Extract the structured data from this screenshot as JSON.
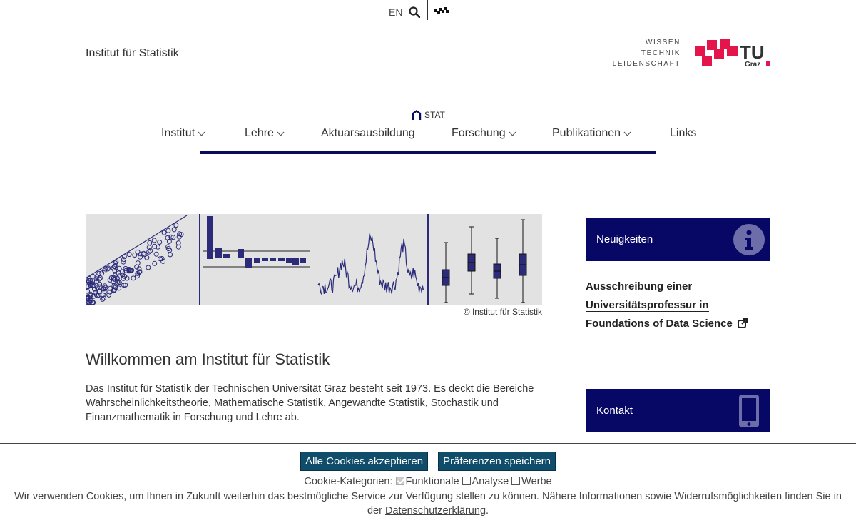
{
  "topbar": {
    "lang": "EN",
    "search_icon": "search-icon",
    "logo_icon": "tu-logo-small-icon"
  },
  "header": {
    "institute": "Institut für Statistik",
    "motto": [
      "WISSEN",
      "TECHNIK",
      "LEIDENSCHAFT"
    ],
    "logo_text": "TU",
    "logo_sub": "Graz"
  },
  "nav": {
    "home_label": "STAT",
    "items": [
      {
        "label": "Institut",
        "dropdown": true
      },
      {
        "label": "Lehre",
        "dropdown": true
      },
      {
        "label": "Aktuarsausbildung",
        "dropdown": false
      },
      {
        "label": "Forschung",
        "dropdown": true
      },
      {
        "label": "Publikationen",
        "dropdown": true
      },
      {
        "label": "Links",
        "dropdown": false
      }
    ]
  },
  "banner": {
    "credit": "© Institut für Statistik"
  },
  "main": {
    "title": "Willkommen am Institut für Statistik",
    "intro": "Das Institut für Statistik der Technischen Universität Graz besteht seit 1973. Es deckt die Bereiche Wahrscheinlichkeitstheorie, Mathematische Statistik, Angewandte Statistik, Stochastik und Finanzmathematik in Forschung und Lehre ab."
  },
  "sidebar": {
    "news_label": "Neuigkeiten",
    "news_link": "Ausschreibung einer Universitätsprofessur in Foundations of Data Science",
    "contact_label": "Kontakt"
  },
  "cookie": {
    "accept_all": "Alle Cookies akzeptieren",
    "save_prefs": "Präferenzen speichern",
    "categories_label": "Cookie-Kategorien:",
    "cat_functional": "Funktionale",
    "cat_analysis": "Analyse",
    "cat_ads": "Werbe",
    "text": "Wir verwenden Cookies, um Ihnen in Zukunft weiterhin das bestmögliche Service zur Verfügung stellen zu können. Nähere Informationen sowie Widerrufsmöglichkeiten finden Sie in der",
    "link": "Datenschutzerklärung",
    "text_end": "."
  },
  "colors": {
    "navy": "#070766",
    "tu_red": "#e4154b",
    "button": "#0f4d6a"
  }
}
